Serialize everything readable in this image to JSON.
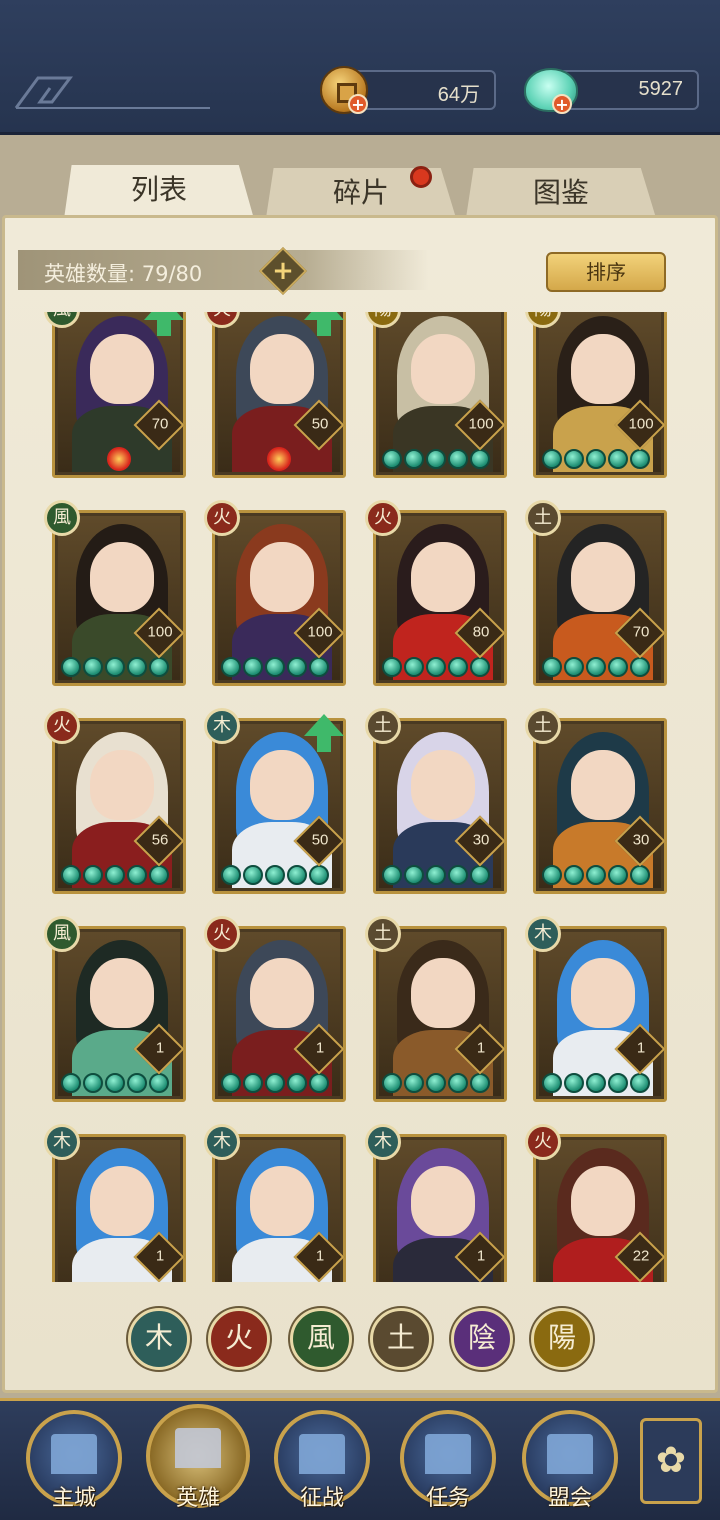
{
  "resources": {
    "coins": "64万",
    "jade": "5927"
  },
  "tabs": [
    {
      "label": "列表",
      "active": true
    },
    {
      "label": "碎片",
      "active": false,
      "has_dot": true
    },
    {
      "label": "图鉴",
      "active": false
    }
  ],
  "hero_count": "英雄数量:  79/80",
  "sort_label": "排序",
  "elements": {
    "wood": {
      "glyph": "木",
      "color": "#2e5e5a"
    },
    "fire": {
      "glyph": "火",
      "color": "#8a2a1c"
    },
    "wind": {
      "glyph": "風",
      "color": "#2f5a2e"
    },
    "earth": {
      "glyph": "土",
      "color": "#5a4a30"
    },
    "yin": {
      "glyph": "陰",
      "color": "#5a2f7a"
    },
    "yang": {
      "glyph": "陽",
      "color": "#8a6a10"
    }
  },
  "heroes": [
    {
      "elem": "wind",
      "level": "70",
      "orbs": 0,
      "up": true,
      "fire_mark": true,
      "hair": "#3a2a5a",
      "body": "#2e3a2a"
    },
    {
      "elem": "fire",
      "level": "50",
      "orbs": 0,
      "up": true,
      "fire_mark": true,
      "hair": "#3d4858",
      "body": "#7a1e1e"
    },
    {
      "elem": "yang",
      "level": "100",
      "orbs": 5,
      "up": false,
      "hair": "#c8bfa4",
      "body": "#3a3624"
    },
    {
      "elem": "yang",
      "level": "100",
      "orbs": 5,
      "up": false,
      "hair": "#2a2018",
      "body": "#c9a24c"
    },
    {
      "elem": "wind",
      "level": "100",
      "orbs": 5,
      "up": false,
      "hair": "#241c16",
      "body": "#3a4a2a"
    },
    {
      "elem": "fire",
      "level": "100",
      "orbs": 5,
      "up": false,
      "hair": "#8a3a1e",
      "body": "#3a2a5a"
    },
    {
      "elem": "fire",
      "level": "80",
      "orbs": 5,
      "up": false,
      "hair": "#2a1c1c",
      "body": "#c0241e"
    },
    {
      "elem": "earth",
      "level": "70",
      "orbs": 5,
      "up": false,
      "hair": "#242424",
      "body": "#c85a1e"
    },
    {
      "elem": "fire",
      "level": "56",
      "orbs": 5,
      "up": false,
      "hair": "#e8e0d0",
      "body": "#8a1e1e"
    },
    {
      "elem": "wood",
      "level": "50",
      "orbs": 5,
      "up": true,
      "hair": "#3a8ad8",
      "body": "#e8ecf0"
    },
    {
      "elem": "earth",
      "level": "30",
      "orbs": 5,
      "up": false,
      "hair": "#d8d4e8",
      "body": "#2a3a5a"
    },
    {
      "elem": "earth",
      "level": "30",
      "orbs": 5,
      "up": false,
      "hair": "#1e3a48",
      "body": "#c87a2a"
    },
    {
      "elem": "wind",
      "level": "1",
      "orbs": 5,
      "up": false,
      "hair": "#1e2a24",
      "body": "#5aaa8a"
    },
    {
      "elem": "fire",
      "level": "1",
      "orbs": 5,
      "up": false,
      "hair": "#3d4858",
      "body": "#7a1e1e"
    },
    {
      "elem": "earth",
      "level": "1",
      "orbs": 5,
      "up": false,
      "hair": "#3a2a1a",
      "body": "#8a5a2a"
    },
    {
      "elem": "wood",
      "level": "1",
      "orbs": 5,
      "up": false,
      "hair": "#3a8ad8",
      "body": "#e8ecf0"
    },
    {
      "elem": "wood",
      "level": "1",
      "orbs": 0,
      "up": false,
      "hair": "#3a8ad8",
      "body": "#e8ecf0"
    },
    {
      "elem": "wood",
      "level": "1",
      "orbs": 0,
      "up": false,
      "hair": "#3a8ad8",
      "body": "#e8ecf0"
    },
    {
      "elem": "wood",
      "level": "1",
      "orbs": 0,
      "up": false,
      "hair": "#6a4a9a",
      "body": "#2a2a3a"
    },
    {
      "elem": "fire",
      "level": "22",
      "orbs": 0,
      "up": false,
      "hair": "#5a2a1e",
      "body": "#b01e1e"
    }
  ],
  "filters": [
    "wood",
    "fire",
    "wind",
    "earth",
    "yin",
    "yang"
  ],
  "nav": [
    {
      "label": "主城",
      "icon": "city-gate-icon"
    },
    {
      "label": "英雄",
      "icon": "hero-portrait-icon",
      "active": true
    },
    {
      "label": "征战",
      "icon": "battle-icon"
    },
    {
      "label": "任务",
      "icon": "scroll-icon"
    },
    {
      "label": "盟会",
      "icon": "pavilion-icon"
    }
  ],
  "menu_icon": "flower-menu-icon"
}
